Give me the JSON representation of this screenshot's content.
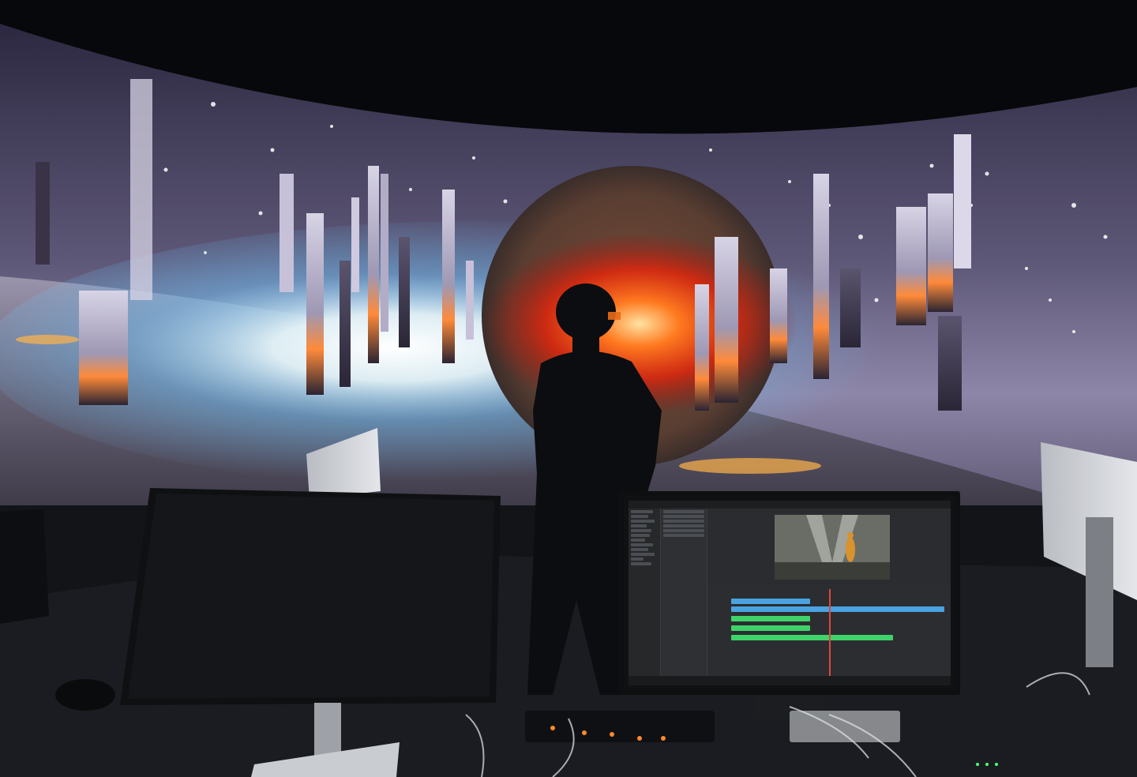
{
  "scene": {
    "description_colors": {
      "sky_top": "#3b3550",
      "sky_mid": "#6b6585",
      "horizon_glow": "#dff6ff",
      "horizon_blue": "#5fc6ff",
      "planet": "#6b4a3a",
      "fire": "#ff3b12",
      "sunset": "#ff7a2a",
      "ceiling": "#07080b",
      "desk": "#1b1c20"
    }
  },
  "editor": {
    "title": "",
    "track_colors": {
      "video": "#4aa3e0",
      "audio": "#3fd26a",
      "playhead": "#e0473f"
    }
  }
}
